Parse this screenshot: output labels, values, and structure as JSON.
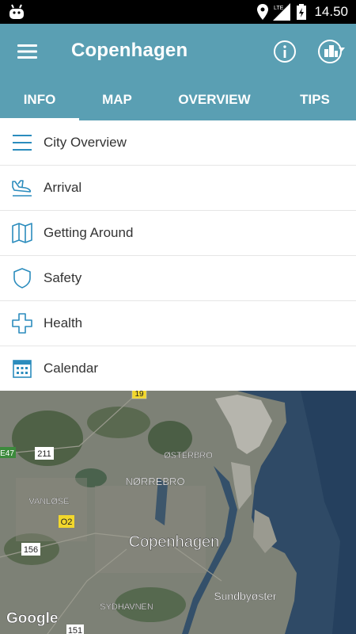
{
  "status": {
    "time": "14.50",
    "network": "LTE"
  },
  "appbar": {
    "title": "Copenhagen"
  },
  "tabs": [
    {
      "label": "INFO",
      "active": true
    },
    {
      "label": "MAP",
      "active": false
    },
    {
      "label": "OVERVIEW",
      "active": false
    },
    {
      "label": "TIPS",
      "active": false
    }
  ],
  "menu_items": [
    {
      "label": "City Overview",
      "icon": "list-icon"
    },
    {
      "label": "Arrival",
      "icon": "plane-landing-icon"
    },
    {
      "label": "Getting Around",
      "icon": "map-icon"
    },
    {
      "label": "Safety",
      "icon": "shield-icon"
    },
    {
      "label": "Health",
      "icon": "cross-icon"
    },
    {
      "label": "Calendar",
      "icon": "calendar-icon"
    }
  ],
  "map": {
    "city_label": "Copenhagen",
    "districts": [
      "ØSTERBRO",
      "NØRREBRO",
      "VANLØSE",
      "SYDHAVNEN",
      "Sundbyøster"
    ],
    "road_shields": [
      "19",
      "211",
      "E47",
      "O2",
      "156",
      "151"
    ],
    "attribution": "Google"
  },
  "colors": {
    "accent": "#5a9fb3",
    "icon": "#2b8cbd"
  }
}
